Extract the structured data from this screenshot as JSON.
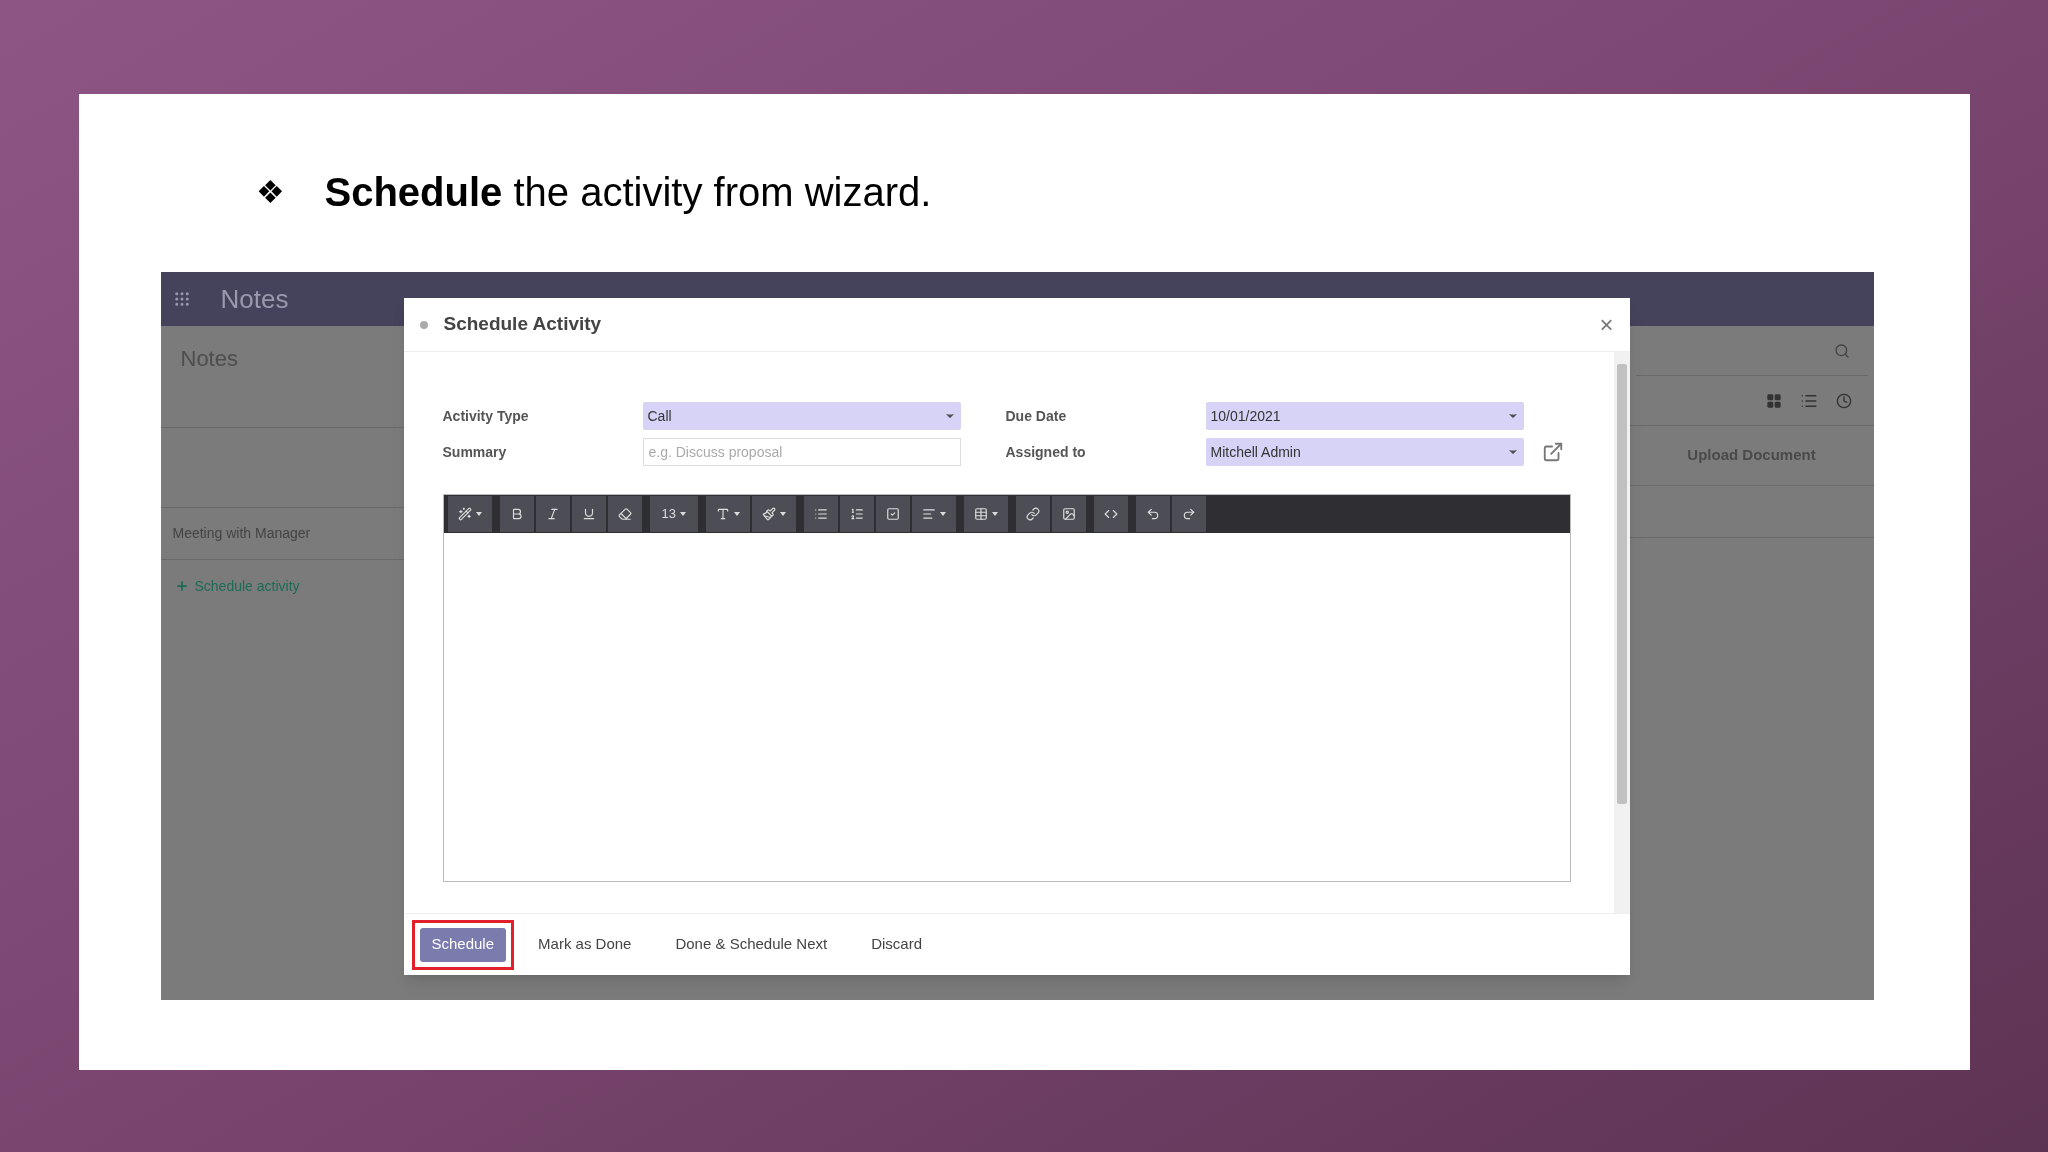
{
  "slide": {
    "heading": "**Schedule** the activity from wizard.",
    "bullet": "❖"
  },
  "app": {
    "app_name": "Notes",
    "breadcrumb": "Notes",
    "record": "Meeting with Manager",
    "schedule_link": "Schedule activity",
    "upload": "Upload Document"
  },
  "dialog": {
    "title": "Schedule Activity",
    "close": "×",
    "fields": [
      {
        "label": "Activity Type",
        "kind": "select",
        "value": "Call"
      },
      {
        "label": "Due Date",
        "kind": "select",
        "value": "10/01/2021"
      },
      {
        "label": "Summary",
        "kind": "text",
        "placeholder": "e.g. Discuss proposal"
      },
      {
        "label": "Assigned to",
        "kind": "select",
        "value": "Mitchell Admin"
      }
    ],
    "font_size": "13",
    "buttons": [
      {
        "label": "Schedule",
        "kind": "primary",
        "highlighted": true
      },
      {
        "label": "Mark as Done",
        "kind": "secondary",
        "highlighted": false
      },
      {
        "label": "Done & Schedule Next",
        "kind": "secondary",
        "highlighted": false
      },
      {
        "label": "Discard",
        "kind": "secondary",
        "highlighted": false
      }
    ]
  }
}
